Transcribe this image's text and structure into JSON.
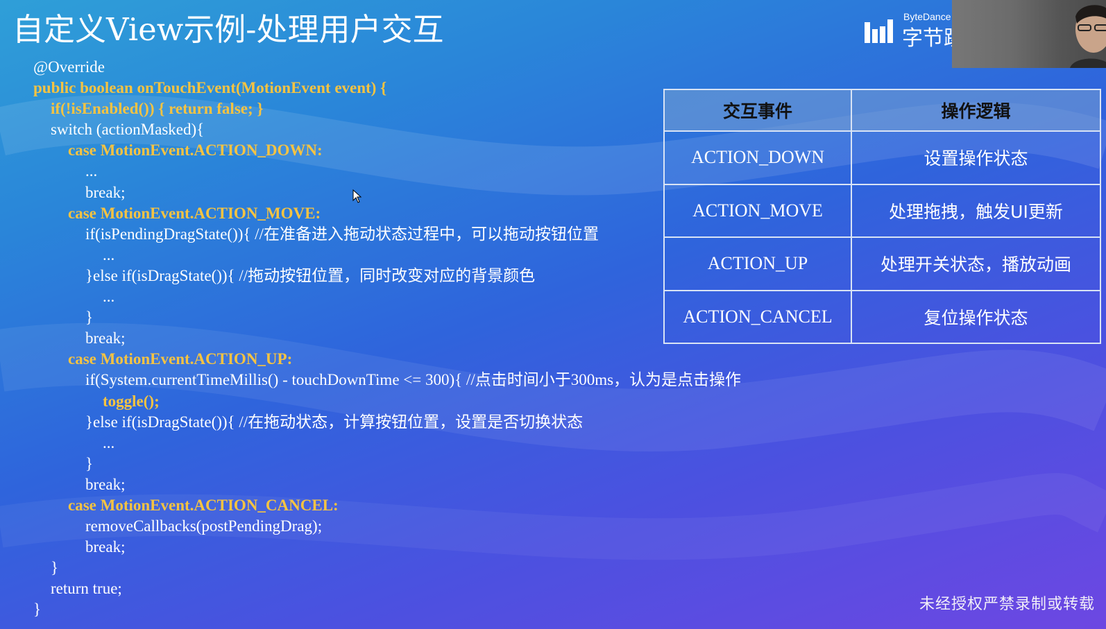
{
  "slide": {
    "title": "自定义View示例-处理用户交互"
  },
  "logo": {
    "brand": "ByteDance",
    "cn": "字节跳"
  },
  "code": {
    "lines": [
      {
        "indent": 0,
        "text": "@Override",
        "kw": false
      },
      {
        "indent": 0,
        "text": "public boolean onTouchEvent(MotionEvent event) {",
        "kw": true
      },
      {
        "indent": 1,
        "text": "if(!isEnabled()) { return false; }",
        "kw": true
      },
      {
        "indent": 1,
        "text": "switch (actionMasked){",
        "kw": false
      },
      {
        "indent": 2,
        "text": "case MotionEvent.ACTION_DOWN:",
        "kw": true
      },
      {
        "indent": 3,
        "text": "...",
        "kw": false
      },
      {
        "indent": 3,
        "text": "break;",
        "kw": false
      },
      {
        "indent": 2,
        "text": "case MotionEvent.ACTION_MOVE:",
        "kw": true
      },
      {
        "indent": 3,
        "text": "if(isPendingDragState()){ //在准备进入拖动状态过程中，可以拖动按钮位置",
        "kw": false
      },
      {
        "indent": 4,
        "text": "...",
        "kw": false
      },
      {
        "indent": 3,
        "text": "}else if(isDragState()){ //拖动按钮位置，同时改变对应的背景颜色",
        "kw": false
      },
      {
        "indent": 4,
        "text": "...",
        "kw": false
      },
      {
        "indent": 3,
        "text": "}",
        "kw": false
      },
      {
        "indent": 3,
        "text": "break;",
        "kw": false
      },
      {
        "indent": 2,
        "text": "case MotionEvent.ACTION_UP:",
        "kw": true
      },
      {
        "indent": 3,
        "text": "if(System.currentTimeMillis() - touchDownTime <= 300){ //点击时间小于300ms，认为是点击操作",
        "kw": false
      },
      {
        "indent": 4,
        "text": "toggle();",
        "kw": true
      },
      {
        "indent": 3,
        "text": "}else if(isDragState()){ //在拖动状态，计算按钮位置，设置是否切换状态",
        "kw": false
      },
      {
        "indent": 4,
        "text": "...",
        "kw": false
      },
      {
        "indent": 3,
        "text": "}",
        "kw": false
      },
      {
        "indent": 3,
        "text": "break;",
        "kw": false
      },
      {
        "indent": 2,
        "text": "case MotionEvent.ACTION_CANCEL:",
        "kw": true
      },
      {
        "indent": 3,
        "text": "removeCallbacks(postPendingDrag);",
        "kw": false
      },
      {
        "indent": 3,
        "text": "break;",
        "kw": false
      },
      {
        "indent": 1,
        "text": "}",
        "kw": false
      },
      {
        "indent": 1,
        "text": "return true;",
        "kw": false
      },
      {
        "indent": 0,
        "text": "}",
        "kw": false
      }
    ]
  },
  "table": {
    "headers": [
      "交互事件",
      "操作逻辑"
    ],
    "rows": [
      {
        "event": "ACTION_DOWN",
        "logic": "设置操作状态"
      },
      {
        "event": "ACTION_MOVE",
        "logic": "处理拖拽，触发UI更新"
      },
      {
        "event": "ACTION_UP",
        "logic": "处理开关状态，播放动画"
      },
      {
        "event": "ACTION_CANCEL",
        "logic": "复位操作状态"
      }
    ]
  },
  "footer": {
    "disclaimer": "未经授权严禁录制或转载"
  },
  "colors": {
    "keyword": "#f5c342",
    "text": "#ffffff",
    "header_bg": "#7aa0d2"
  }
}
